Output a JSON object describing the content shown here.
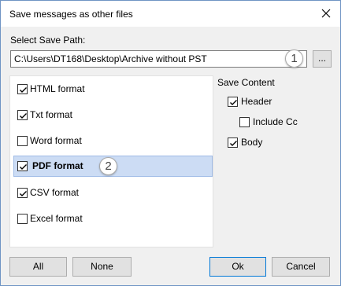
{
  "window": {
    "title": "Save messages as other files"
  },
  "path": {
    "label": "Select Save Path:",
    "value": "C:\\Users\\DT168\\Desktop\\Archive without PST",
    "browse_label": "..."
  },
  "badges": {
    "one": "1",
    "two": "2"
  },
  "formats": [
    {
      "label": "HTML format",
      "checked": true
    },
    {
      "label": "Txt format",
      "checked": true
    },
    {
      "label": "Word format",
      "checked": false
    },
    {
      "label": "PDF format",
      "checked": true,
      "selected": true
    },
    {
      "label": "CSV format",
      "checked": true
    },
    {
      "label": "Excel format",
      "checked": false
    }
  ],
  "save_content": {
    "label": "Save Content",
    "header": {
      "label": "Header",
      "checked": true
    },
    "include_cc": {
      "label": "Include Cc",
      "checked": false
    },
    "body": {
      "label": "Body",
      "checked": true
    }
  },
  "buttons": {
    "all": "All",
    "none": "None",
    "ok": "Ok",
    "cancel": "Cancel"
  },
  "colors": {
    "selection": "#ccdcf4",
    "accent_border": "#0078d7",
    "window_border": "#6f94c4"
  },
  "icons": {
    "close": "close-icon",
    "check": "check-icon"
  }
}
